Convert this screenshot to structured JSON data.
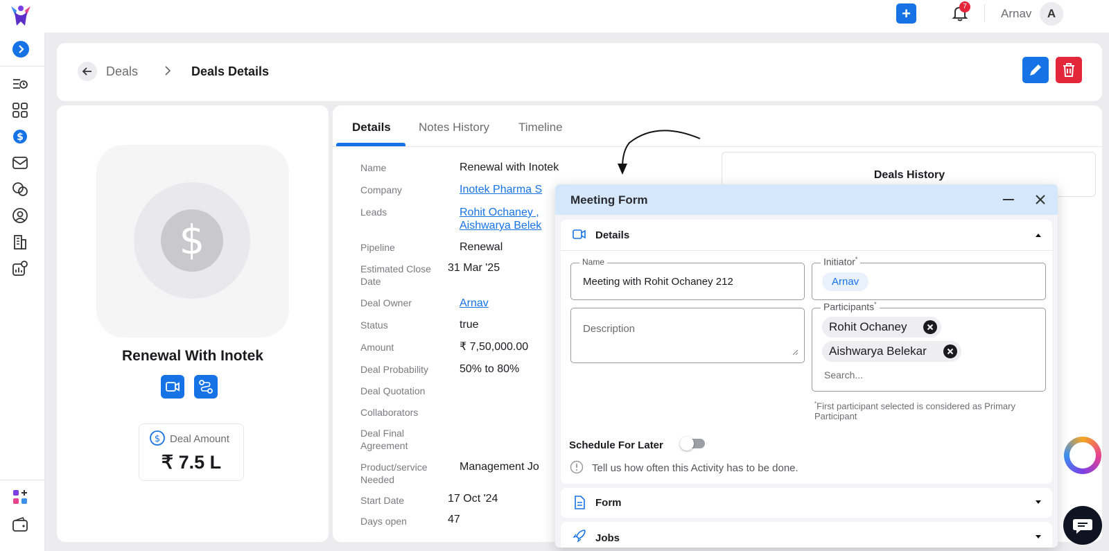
{
  "topbar": {
    "notification_count": "7",
    "user_name": "Arnav",
    "user_initial": "A",
    "add_label": "+"
  },
  "nav": {
    "items": [
      "deals-list-icon",
      "apps-grid-icon",
      "dollar-icon",
      "mail-icon",
      "chat-bubbles-icon",
      "user-circle-icon",
      "building-icon",
      "settings-panel-icon"
    ],
    "active": "dollar-icon"
  },
  "header": {
    "breadcrumb_parent": "Deals",
    "breadcrumb_current": "Deals Details"
  },
  "profile": {
    "name": "Renewal With Inotek",
    "amount_label": "Deal Amount",
    "amount_value": "₹ 7.5 L"
  },
  "tabs": [
    "Details",
    "Notes History",
    "Timeline"
  ],
  "details": {
    "name_label": "Name",
    "name_value": "Renewal with Inotek",
    "company_label": "Company",
    "company_value": "Inotek Pharma S",
    "leads_label": "Leads",
    "leads_value_1": "Rohit Ochaney ,",
    "leads_value_2": "Aishwarya Belek",
    "pipeline_label": "Pipeline",
    "pipeline_value": "Renewal",
    "close_date_label_1": "Estimated Close",
    "close_date_label_2": "Date",
    "close_date_value": "31 Mar '25",
    "owner_label": "Deal Owner",
    "owner_value": "Arnav",
    "status_label": "Status",
    "status_value": "true",
    "amount_label": "Amount",
    "amount_value": "₹ 7,50,000.00",
    "probability_label": "Deal Probability",
    "probability_value": "50% to 80%",
    "quotation_label": "Deal Quotation",
    "collaborators_label": "Collaborators",
    "final_agreement_label_1": "Deal Final",
    "final_agreement_label_2": "Agreement",
    "product_label_1": "Product/service",
    "product_label_2": "Needed",
    "product_value": "Management Jo",
    "start_date_label": "Start Date",
    "start_date_value": "17 Oct '24",
    "days_open_label": "Days open",
    "days_open_value": "47"
  },
  "history": {
    "title": "Deals History"
  },
  "meeting_form": {
    "title": "Meeting Form",
    "details_section": "Details",
    "name_legend": "Name",
    "name_value": "Meeting with Rohit Ochaney 212",
    "initiator_legend": "Initiator",
    "initiator_value": "Arnav",
    "description_placeholder": "Description",
    "participants_legend": "Participants",
    "participants": [
      "Rohit Ochaney",
      "Aishwarya Belekar"
    ],
    "search_placeholder": "Search...",
    "required_mark": "*",
    "participant_note": "First participant selected is considered as Primary Participant",
    "schedule_label": "Schedule For Later",
    "frequency_hint": "Tell us how often this Activity has to be done.",
    "form_section": "Form",
    "jobs_section": "Jobs"
  }
}
